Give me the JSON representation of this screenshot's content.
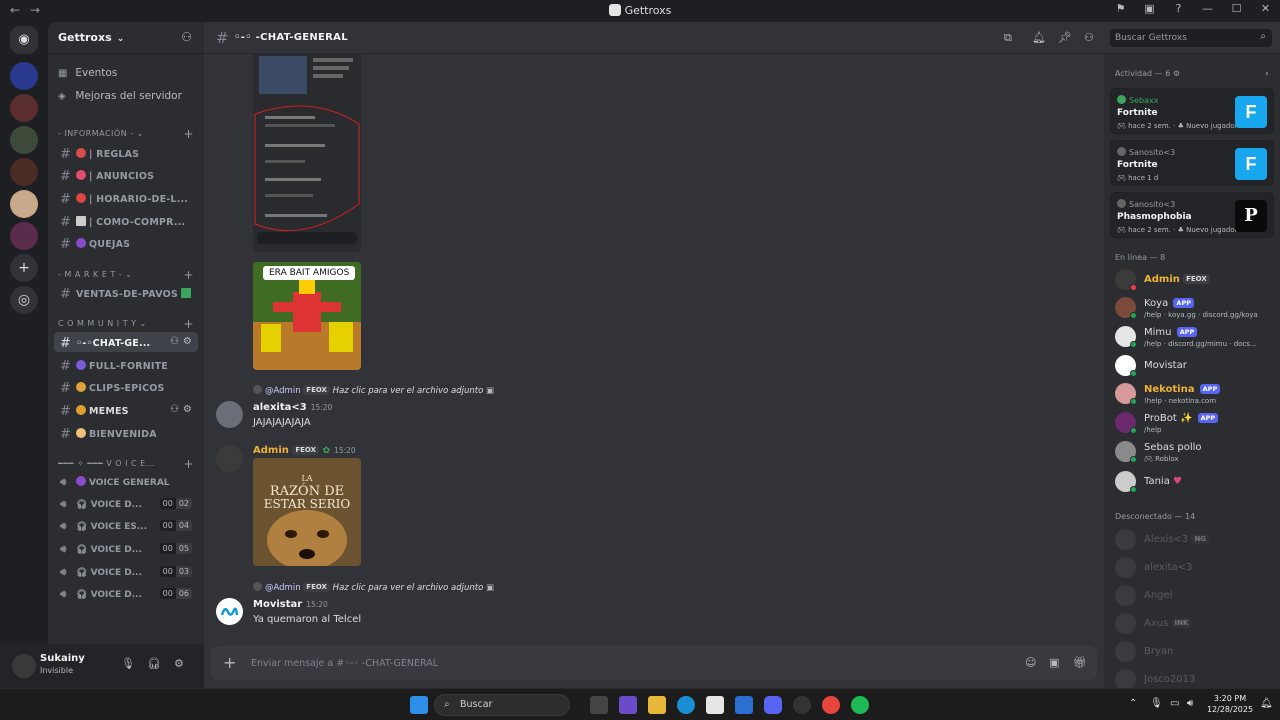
{
  "window": {
    "title": "Gettroxs"
  },
  "server": {
    "name": "Gettroxs"
  },
  "quick_links": [
    "Eventos",
    "Mejoras del servidor"
  ],
  "categories": {
    "info": "INFORMACIÓN",
    "market": "- M A R K E T -",
    "community": "C O M M U N I T Y",
    "voice": "V O I C E..."
  },
  "channels": [
    {
      "label": "| REGLAS"
    },
    {
      "label": "| ANUNCIOS"
    },
    {
      "label": "| HORARIO-DE-L..."
    },
    {
      "label": "| COMO-COMPR..."
    },
    {
      "label": "QUEJAS"
    },
    {
      "label": "VENTAS-DE-PAVOS"
    },
    {
      "label": "◦-◦CHAT-GE..."
    },
    {
      "label": "FULL-FORNITE"
    },
    {
      "label": "CLIPS-EPICOS"
    },
    {
      "label": "MEMES"
    },
    {
      "label": "BIENVENIDA"
    }
  ],
  "voice_channels": [
    {
      "label": "VOICE GENERAL"
    },
    {
      "label": "VOICE D...",
      "count": "00",
      "limit": "02"
    },
    {
      "label": "VOICE ES...",
      "count": "00",
      "limit": "04"
    },
    {
      "label": "VOICE D...",
      "count": "00",
      "limit": "05"
    },
    {
      "label": "VOICE D...",
      "count": "00",
      "limit": "03"
    },
    {
      "label": "VOICE D...",
      "count": "00",
      "limit": "06"
    }
  ],
  "user": {
    "name": "Sukainy",
    "status": "Invisible"
  },
  "header": {
    "channel": "◦-◦ -CHAT-GENERAL",
    "search_placeholder": "Buscar Gettroxs"
  },
  "messages": {
    "image_caption": "ERA BAIT AMIGOS",
    "reply1": {
      "mention": "@Admin",
      "tag": "FEOX",
      "text": "Haz clic para ver el archivo adjunto"
    },
    "msg1": {
      "author": "alexita<3",
      "time": "15:20",
      "text": "JAJAJAJAJAJA"
    },
    "msg2": {
      "author": "Admin",
      "tag": "FEOX",
      "time": "15:20",
      "poster_line1": "LA",
      "poster_line2": "RAZÓN DE",
      "poster_line3": "ESTAR SERIO"
    },
    "reply2": {
      "mention": "@Admin",
      "tag": "FEOX",
      "text": "Haz clic para ver el archivo adjunto"
    },
    "msg3": {
      "author": "Movistar",
      "time": "15:20",
      "text": "Ya quemaron al Telcel"
    }
  },
  "composer": {
    "placeholder": "Enviar mensaje a #◦-◦ -CHAT-GENERAL"
  },
  "activity": {
    "header": "Actividad — 6",
    "items": [
      {
        "user": "Sebaxx",
        "game": "Fortnite",
        "ago": "hace 2 sem.",
        "badge": "Nuevo jugador",
        "icon": "F"
      },
      {
        "user": "Sanosito<3",
        "game": "Fortnite",
        "ago": "hace 1 d",
        "badge": "",
        "icon": "F"
      },
      {
        "user": "Sanosito<3",
        "game": "Phasmophobia",
        "ago": "hace 2 sem.",
        "badge": "Nuevo jugador",
        "icon": "P"
      }
    ]
  },
  "online": {
    "header": "En línea — 8",
    "members": [
      {
        "name": "Admin",
        "tag": "FEOX",
        "sub": "",
        "color": "#f0b232"
      },
      {
        "name": "Koya",
        "app": "APP",
        "sub": "/help · koya.gg · discord.gg/koya",
        "color": "#dbdee1"
      },
      {
        "name": "Mimu",
        "app": "APP",
        "sub": "/help · discord.gg/mimu · docs...",
        "color": "#dbdee1"
      },
      {
        "name": "Movistar",
        "sub": "",
        "color": "#dbdee1"
      },
      {
        "name": "Nekotina",
        "app": "APP",
        "sub": "!help · nekotina.com",
        "color": "#f0b232"
      },
      {
        "name": "ProBot",
        "app": "APP",
        "sub": "/help",
        "color": "#dbdee1"
      },
      {
        "name": "Sebas pollo",
        "sub": "Roblox",
        "color": "#dbdee1"
      },
      {
        "name": "Tania",
        "sub": "",
        "color": "#dbdee1"
      }
    ]
  },
  "offline": {
    "header": "Desconectado — 14",
    "members": [
      {
        "name": "Alexis<3",
        "tag": "NG"
      },
      {
        "name": "alexita<3"
      },
      {
        "name": "Angel"
      },
      {
        "name": "Axus",
        "tag": "INK"
      },
      {
        "name": "Bryan"
      },
      {
        "name": "Josco2013"
      }
    ]
  },
  "taskbar": {
    "search": "Buscar",
    "time": "3:20 PM",
    "date": "12/28/2025"
  }
}
